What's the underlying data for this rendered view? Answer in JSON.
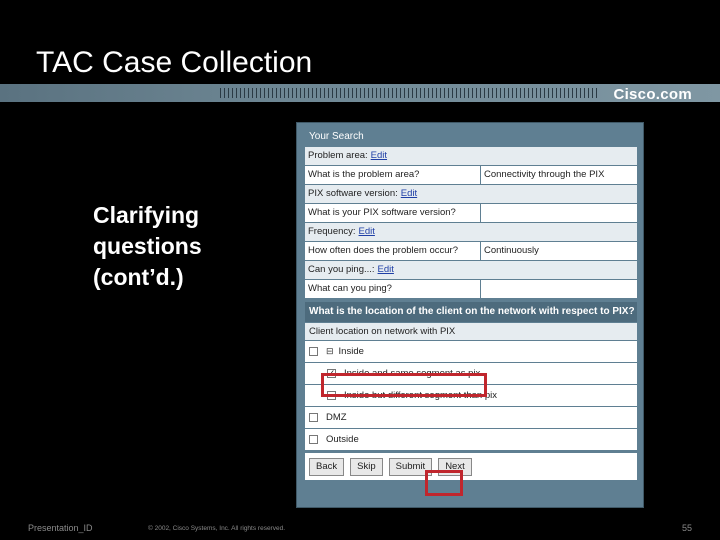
{
  "slide": {
    "title": "TAC Case Collection",
    "brand": "Cisco.com",
    "side_text_lines": [
      "Clarifying",
      "questions",
      "(cont’d.)"
    ],
    "footer_left": "Presentation_ID",
    "footer_mid": "© 2002, Cisco Systems, Inc. All rights reserved.",
    "footer_right": "55"
  },
  "panel": {
    "header": "Your Search",
    "edit_label": "Edit",
    "groups": [
      {
        "label": "Problem area:",
        "question": "What is the problem area?",
        "answer": "Connectivity through the PIX"
      },
      {
        "label": "PIX software version:",
        "question": "What is your PIX software version?",
        "answer": ""
      },
      {
        "label": "Frequency:",
        "question": "How often does the problem occur?",
        "answer": "Continuously"
      },
      {
        "label": "Can you ping...:",
        "question": "What can you ping?",
        "answer": ""
      }
    ],
    "question_header": "What is the location of the client on the network with respect to PIX?",
    "options_label": "Client location on network with PIX",
    "options": {
      "inside": "Inside",
      "sub1": "Inside and same segment as pix",
      "sub2": "Inside but different segment than pix",
      "dmz": "DMZ",
      "outside": "Outside"
    },
    "buttons": {
      "back": "Back",
      "skip": "Skip",
      "submit": "Submit",
      "next": "Next"
    },
    "highlight_color": "#c0262d"
  }
}
